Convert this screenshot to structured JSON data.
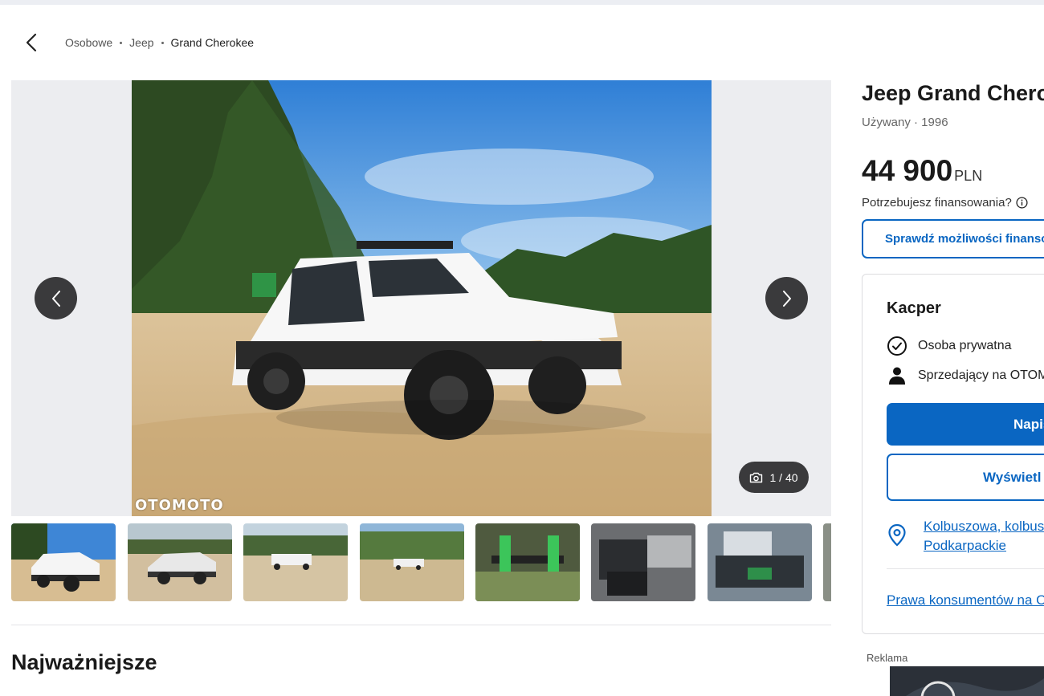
{
  "breadcrumb": {
    "back_icon": "chevron-left-icon",
    "items": [
      "Osobowe",
      "Jeep",
      "Grand Cherokee"
    ]
  },
  "gallery": {
    "watermark": "OTOMOTO",
    "counter": "1 / 40",
    "camera_icon": "camera-icon",
    "prev_icon": "chevron-left-icon",
    "next_icon": "chevron-right-icon"
  },
  "section": {
    "title": "Najważniejsze"
  },
  "listing": {
    "title": "Jeep Grand Cherokee",
    "subtitle": "Używany · 1996",
    "price": "44 900",
    "currency": "PLN",
    "finance_question": "Potrzebujesz finansowania?",
    "finance_button": "Sprawdź możliwości finansowania"
  },
  "seller": {
    "name": "Kacper",
    "type": "Osoba prywatna",
    "since": "Sprzedający na OTOMOTO",
    "primary_button": "Napisz",
    "secondary_button": "Wyświetl",
    "location_line1": "Kolbuszowa, kolbuszowski,",
    "location_line2": "Podkarpackie",
    "rights_link": "Prawa konsumentów na OTOMOTO"
  },
  "ad": {
    "label": "Reklama"
  },
  "colors": {
    "accent": "#0a66c2",
    "nav_button": "#3a3a3c"
  }
}
